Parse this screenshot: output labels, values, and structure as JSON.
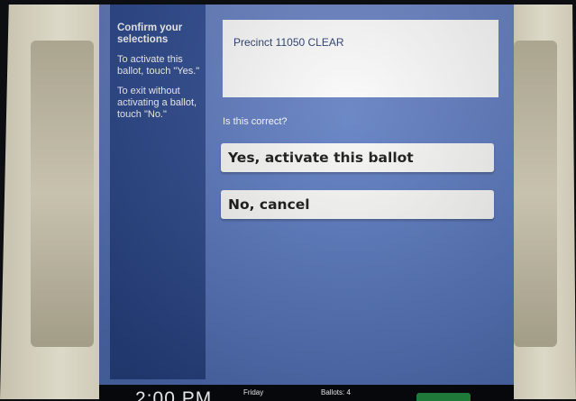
{
  "instructions": {
    "title": "Confirm your selections",
    "activate": "To activate this ballot, touch \"Yes.\"",
    "exit": "To exit without activating a ballot, touch \"No.\""
  },
  "precinct": {
    "label": "Precinct 11050 CLEAR"
  },
  "prompt": {
    "question": "Is this correct?"
  },
  "buttons": {
    "yes_label": "Yes, activate this ballot",
    "no_label": "No, cancel"
  },
  "status_bar": {
    "time": "2:00 PM",
    "day": "Friday",
    "ballots": "Ballots: 4"
  },
  "colors": {
    "screen_background": "#5978bf",
    "instruction_panel": "#2e4c93",
    "button_face": "#f7f7f5",
    "status_light": "#1f7a3a"
  }
}
